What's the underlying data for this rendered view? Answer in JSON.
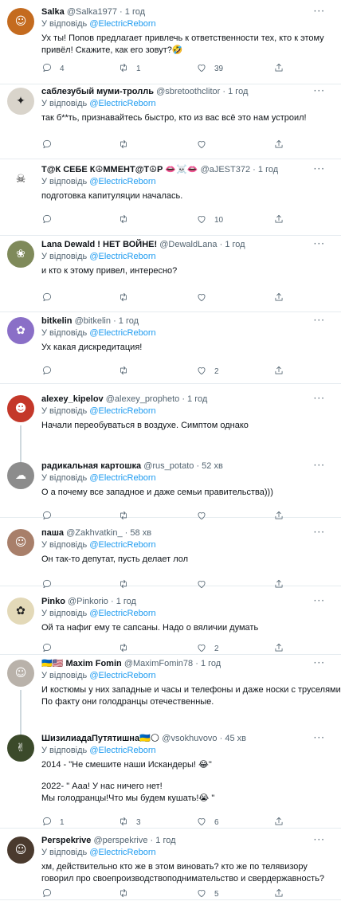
{
  "reply_prefix": "У відповідь",
  "tweets": [
    {
      "name": "Salka",
      "handle": "@Salka1977",
      "dot": "·",
      "time": "1 год",
      "mention": "@ElectricReborn",
      "lines": [
        "Ух ты! Попов предлагает привлечь к ответственности тех, кто к этому",
        "привёл! Скажите, как его зовут?🤣"
      ],
      "replies": "4",
      "retweets": "1",
      "likes": "39",
      "avatar_color": "#c46b1f",
      "avatar_glyph": "☺"
    },
    {
      "name": "саблезубый муми-тролль",
      "handle": "@sbretoothclitor",
      "dot": "·",
      "time": "1 год",
      "mention": "@ElectricReborn",
      "lines": [
        "так б**ть, признавайтесь быстро, кто из вас всё это нам устроил!"
      ],
      "replies": "",
      "retweets": "",
      "likes": "",
      "avatar_color": "#d9d4cb",
      "avatar_glyph": "✦"
    },
    {
      "name": "Т@К СЕБЕ К☮ММЕНТ@Т☮Р 👄☠️👄",
      "handle": "@aJEST372",
      "dot": "·",
      "time": "1 год",
      "mention": "@ElectricReborn",
      "lines": [
        "подготовка капитуляции началась."
      ],
      "replies": "",
      "retweets": "",
      "likes": "10",
      "avatar_color": "#ffffff",
      "avatar_glyph": "☠"
    },
    {
      "name": "Lana Dewald ! НЕТ ВОЙНЕ!",
      "handle": "@DewaldLana",
      "dot": "·",
      "time": "1 год",
      "mention": "@ElectricReborn",
      "lines": [
        "и кто к этому привел, интересно?"
      ],
      "replies": "",
      "retweets": "",
      "likes": "",
      "avatar_color": "#7f8a5a",
      "avatar_glyph": "❀"
    },
    {
      "name": "bitkelin",
      "handle": "@bitkelin",
      "dot": "·",
      "time": "1 год",
      "mention": "@ElectricReborn",
      "lines": [
        "Ух какая дискредитация!"
      ],
      "replies": "",
      "retweets": "",
      "likes": "2",
      "avatar_color": "#8a6fc7",
      "avatar_glyph": "✿"
    },
    {
      "name": "alexey_kipelov",
      "handle": "@alexey_propheto",
      "dot": "·",
      "time": "1 год",
      "mention": "@ElectricReborn",
      "lines": [
        "Начали переобуваться в воздухе. Симптом однако"
      ],
      "replies": "",
      "retweets": "",
      "likes": "",
      "avatar_color": "#c4382a",
      "avatar_glyph": "☻"
    },
    {
      "name": "радикальная картошка",
      "handle": "@rus_potato",
      "dot": "·",
      "time": "52 хв",
      "mention": "@ElectricReborn",
      "lines": [
        "О а почему все западное и даже семьи правительства)))"
      ],
      "replies": "",
      "retweets": "",
      "likes": "",
      "avatar_color": "#8c8c8c",
      "avatar_glyph": "☁"
    },
    {
      "name": "паша",
      "handle": "@Zakhvatkin_",
      "dot": "·",
      "time": "58 хв",
      "mention": "@ElectricReborn",
      "lines": [
        "Он так-то депутат, пусть делает лол"
      ],
      "replies": "",
      "retweets": "",
      "likes": "",
      "avatar_color": "#a87f6a",
      "avatar_glyph": "☺"
    },
    {
      "name": "Pinko",
      "handle": "@Pinkorio",
      "dot": "·",
      "time": "1 год",
      "mention": "@ElectricReborn",
      "lines": [
        "Ой та нафиг ему те сапсаны. Надо о вяличии думать"
      ],
      "replies": "",
      "retweets": "",
      "likes": "2",
      "avatar_color": "#e3d9b8",
      "avatar_glyph": "✿"
    },
    {
      "name": "🇺🇦🇺🇸 Maxim Fomin",
      "handle": "@MaximFomin78",
      "dot": "·",
      "time": "1 год",
      "mention": "@ElectricReborn",
      "lines": [
        "И костюмы у них западные и часы и телефоны и даже носки с труселями.",
        "По факту они голодранцы отечественные."
      ],
      "replies": "",
      "retweets": "",
      "likes": "",
      "avatar_color": "#b9b2aa",
      "avatar_glyph": "☺"
    },
    {
      "name": "ШизилиадаПутятишна🇺🇦🌕",
      "handle": "@vsokhuvovo",
      "dot": "·",
      "time": "45 хв",
      "mention": "@ElectricReborn",
      "lines": [
        "2014 - \"Не смешите наши Искандеры! 😂\"",
        "",
        "2022- \" Ааа! У нас ничего нет!",
        "Мы голодранцы!Что мы будем кушать!😭 \""
      ],
      "replies": "1",
      "retweets": "3",
      "likes": "6",
      "avatar_color": "#3b4a2a",
      "avatar_glyph": "✌"
    },
    {
      "name": "Perspekrive",
      "handle": "@perspekrive",
      "dot": "·",
      "time": "1 год",
      "mention": "@ElectricReborn",
      "lines": [
        "хм, действительно кто же в этом виновать? кто же по телявизору",
        "говорил про своепроизводствоподнимательство и свердержавность?"
      ],
      "replies": "",
      "retweets": "",
      "likes": "5",
      "avatar_color": "#4a3a2e",
      "avatar_glyph": "☺"
    }
  ]
}
